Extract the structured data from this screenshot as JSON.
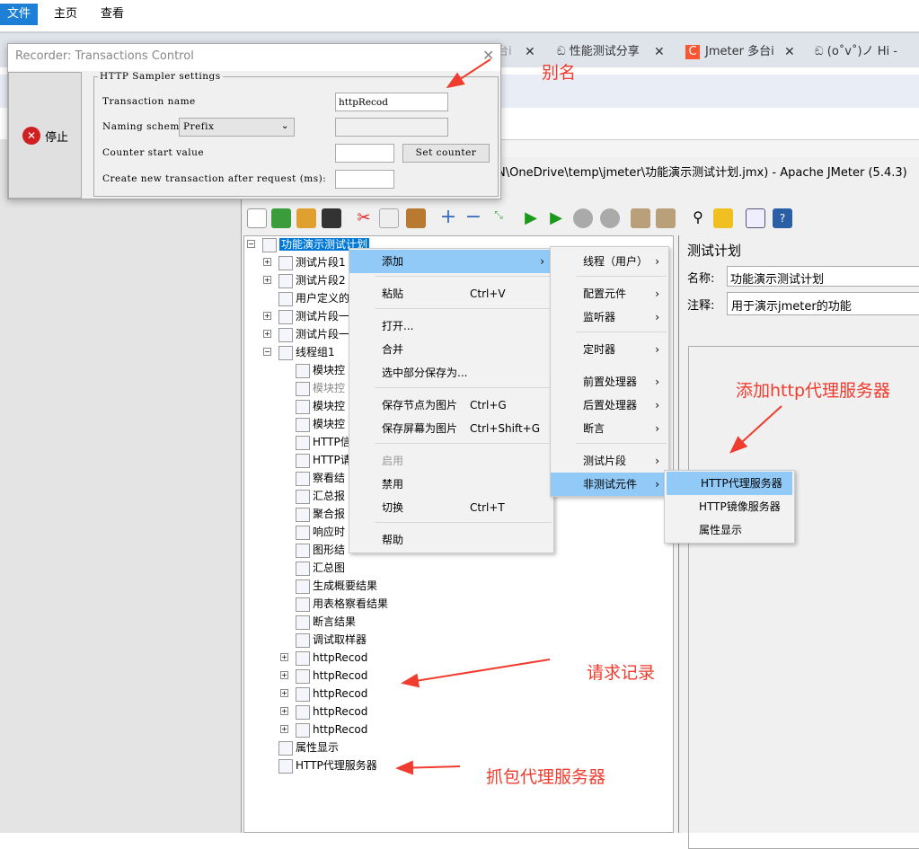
{
  "menubar": {
    "items": [
      "文件",
      "主页",
      "查看"
    ]
  },
  "browser_tabs": [
    {
      "label": "台ⅰ"
    },
    {
      "label": "性能测试分享"
    },
    {
      "label": "Jmeter 多台ⅰ"
    },
    {
      "label": "(o˚v˚)ノ Hi -"
    }
  ],
  "window_title": "N\\OneDrive\\temp\\jmeter\\功能演示测试计划.jmx) - Apache JMeter (5.4.3)",
  "dialog": {
    "title": "Recorder: Transactions Control",
    "stop_label": "停止",
    "group_title": "HTTP Sampler settings",
    "transaction_name_label": "Transaction name",
    "transaction_name_value": "httpRecod",
    "naming_scheme_label": "Naming scheme",
    "naming_scheme_value": "Prefix",
    "counter_label": "Counter start value",
    "set_counter": "Set counter",
    "create_label": "Create new transaction after request (ms):"
  },
  "tree": {
    "root": "功能演示测试计划",
    "level1": [
      {
        "label": "测试片段1",
        "exp": "+"
      },
      {
        "label": "测试片段2",
        "exp": "+"
      },
      {
        "label": "用户定义的",
        "exp": ""
      },
      {
        "label": "测试片段一",
        "exp": "+"
      },
      {
        "label": "测试片段一",
        "exp": "+"
      },
      {
        "label": "线程组1",
        "exp": "-"
      }
    ],
    "level2": [
      "模块控",
      "模块控",
      "模块控",
      "模块控",
      "HTTP信",
      "HTTP请",
      "察看结",
      "汇总报",
      "聚合报",
      "响应时",
      "图形结",
      "汇总图",
      "生成概要结果",
      "用表格察看结果",
      "断言结果",
      "调试取样器",
      "httpRecod",
      "httpRecod",
      "httpRecod",
      "httpRecod",
      "httpRecod"
    ],
    "tail": [
      "属性显示",
      "HTTP代理服务器"
    ]
  },
  "context_menu": [
    {
      "label": "添加",
      "arrow": "›"
    },
    {
      "label": "粘贴",
      "shortcut": "Ctrl+V"
    },
    {
      "label": "打开..."
    },
    {
      "label": "合并"
    },
    {
      "label": "选中部分保存为..."
    },
    {
      "label": "保存节点为图片",
      "shortcut": "Ctrl+G"
    },
    {
      "label": "保存屏幕为图片",
      "shortcut": "Ctrl+Shift+G"
    },
    {
      "label": "启用"
    },
    {
      "label": "禁用"
    },
    {
      "label": "切换",
      "shortcut": "Ctrl+T"
    },
    {
      "label": "帮助"
    }
  ],
  "submenu": [
    "线程（用户）",
    "配置元件",
    "监听器",
    "定时器",
    "前置处理器",
    "后置处理器",
    "断言",
    "测试片段",
    "非测试元件"
  ],
  "subsubmenu": [
    "HTTP代理服务器",
    "HTTP镜像服务器",
    "属性显示"
  ],
  "right_panel": {
    "title": "测试计划",
    "name_label": "名称:",
    "name_value": "功能演示测试计划",
    "comment_label": "注释:",
    "comment_value": "用于演示jmeter的功能"
  },
  "annotations": {
    "alias": "别名",
    "add_proxy": "添加http代理服务器",
    "records": "请求记录",
    "proxy": "抓包代理服务器"
  },
  "colors": {
    "highlight": "#91c9f7",
    "selection": "#0078d7",
    "annotation": "#f03c2e"
  }
}
